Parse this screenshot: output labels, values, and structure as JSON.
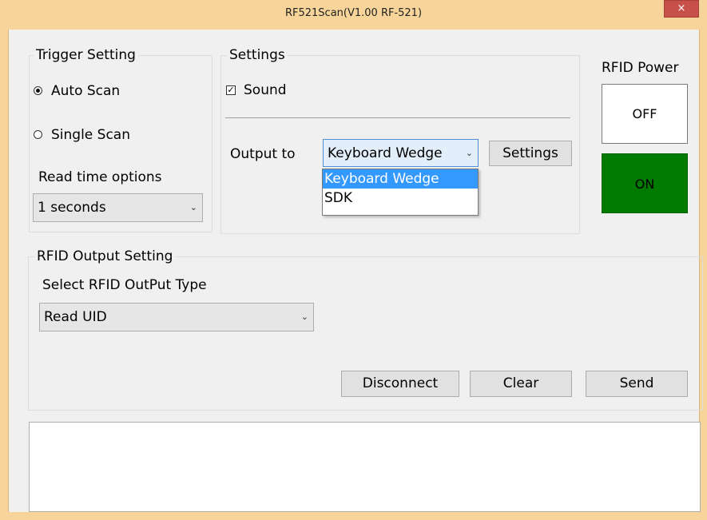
{
  "window": {
    "title": "RF521Scan(V1.00 RF-521)",
    "close_label": "×"
  },
  "trigger": {
    "legend": "Trigger Setting",
    "auto_scan": "Auto Scan",
    "auto_scan_selected": true,
    "single_scan": "Single Scan",
    "single_scan_selected": false,
    "read_time_label": "Read time options",
    "read_time_value": "1 seconds"
  },
  "settings": {
    "legend": "Settings",
    "sound_label": "Sound",
    "sound_checked": true,
    "output_label": "Output to",
    "output_value": "Keyboard Wedge",
    "settings_button": "Settings",
    "output_options": [
      "Keyboard Wedge",
      "SDK"
    ],
    "output_selected_option": "Keyboard Wedge"
  },
  "power": {
    "label": "RFID Power",
    "off_label": "OFF",
    "on_label": "ON",
    "on_color": "#007a00"
  },
  "rfid_output": {
    "legend": "RFID Output Setting",
    "type_label": "Select RFID OutPut Type",
    "type_value": "Read UID"
  },
  "actions": {
    "disconnect": "Disconnect",
    "clear": "Clear",
    "send": "Send"
  },
  "output_text": ""
}
